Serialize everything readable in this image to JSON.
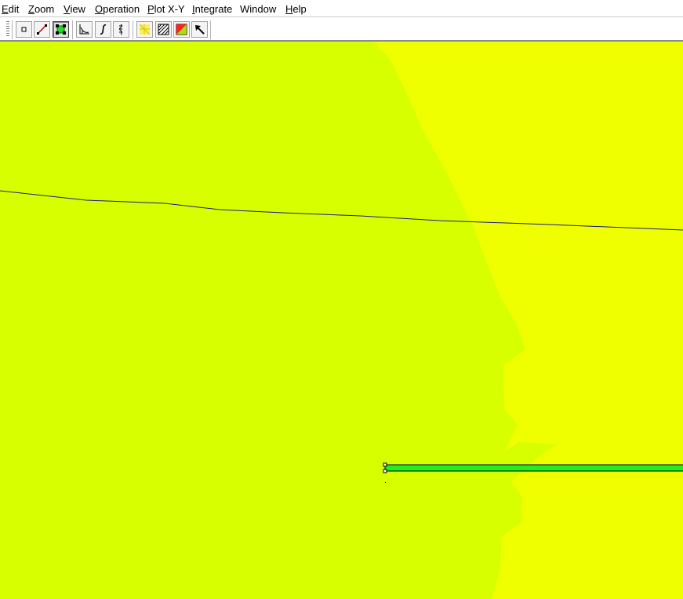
{
  "menubar": {
    "items": [
      {
        "label": "Edit",
        "mnemonic": "E"
      },
      {
        "label": "Zoom",
        "mnemonic": "Z"
      },
      {
        "label": "View",
        "mnemonic": "V"
      },
      {
        "label": "Operation",
        "mnemonic": "O"
      },
      {
        "label": "Plot X-Y",
        "mnemonic": "P"
      },
      {
        "label": "Integrate",
        "mnemonic": "I"
      },
      {
        "label": "Window",
        "mnemonic": ""
      },
      {
        "label": "Help",
        "mnemonic": "H"
      }
    ]
  },
  "toolbar": {
    "buttons": [
      {
        "icon": "node-icon",
        "state": "normal"
      },
      {
        "icon": "segment-icon",
        "state": "normal"
      },
      {
        "icon": "block-label-icon",
        "state": "pressed"
      },
      {
        "icon": "plot-xy-icon",
        "state": "normal"
      },
      {
        "icon": "integrate-icon",
        "state": "normal"
      },
      {
        "icon": "contour-icon",
        "state": "normal"
      },
      {
        "icon": "mesh-icon",
        "state": "normal"
      },
      {
        "icon": "hatch-icon",
        "state": "normal"
      },
      {
        "icon": "density-plot-icon",
        "state": "normal"
      },
      {
        "icon": "select-arrow-icon",
        "state": "normal"
      }
    ]
  },
  "canvas": {
    "colors": {
      "region_left": "#d7ff00",
      "region_right": "#f0ff00",
      "contour_line": "#1a1a8c",
      "block": "#22ee22",
      "block_outline": "#000000"
    }
  }
}
